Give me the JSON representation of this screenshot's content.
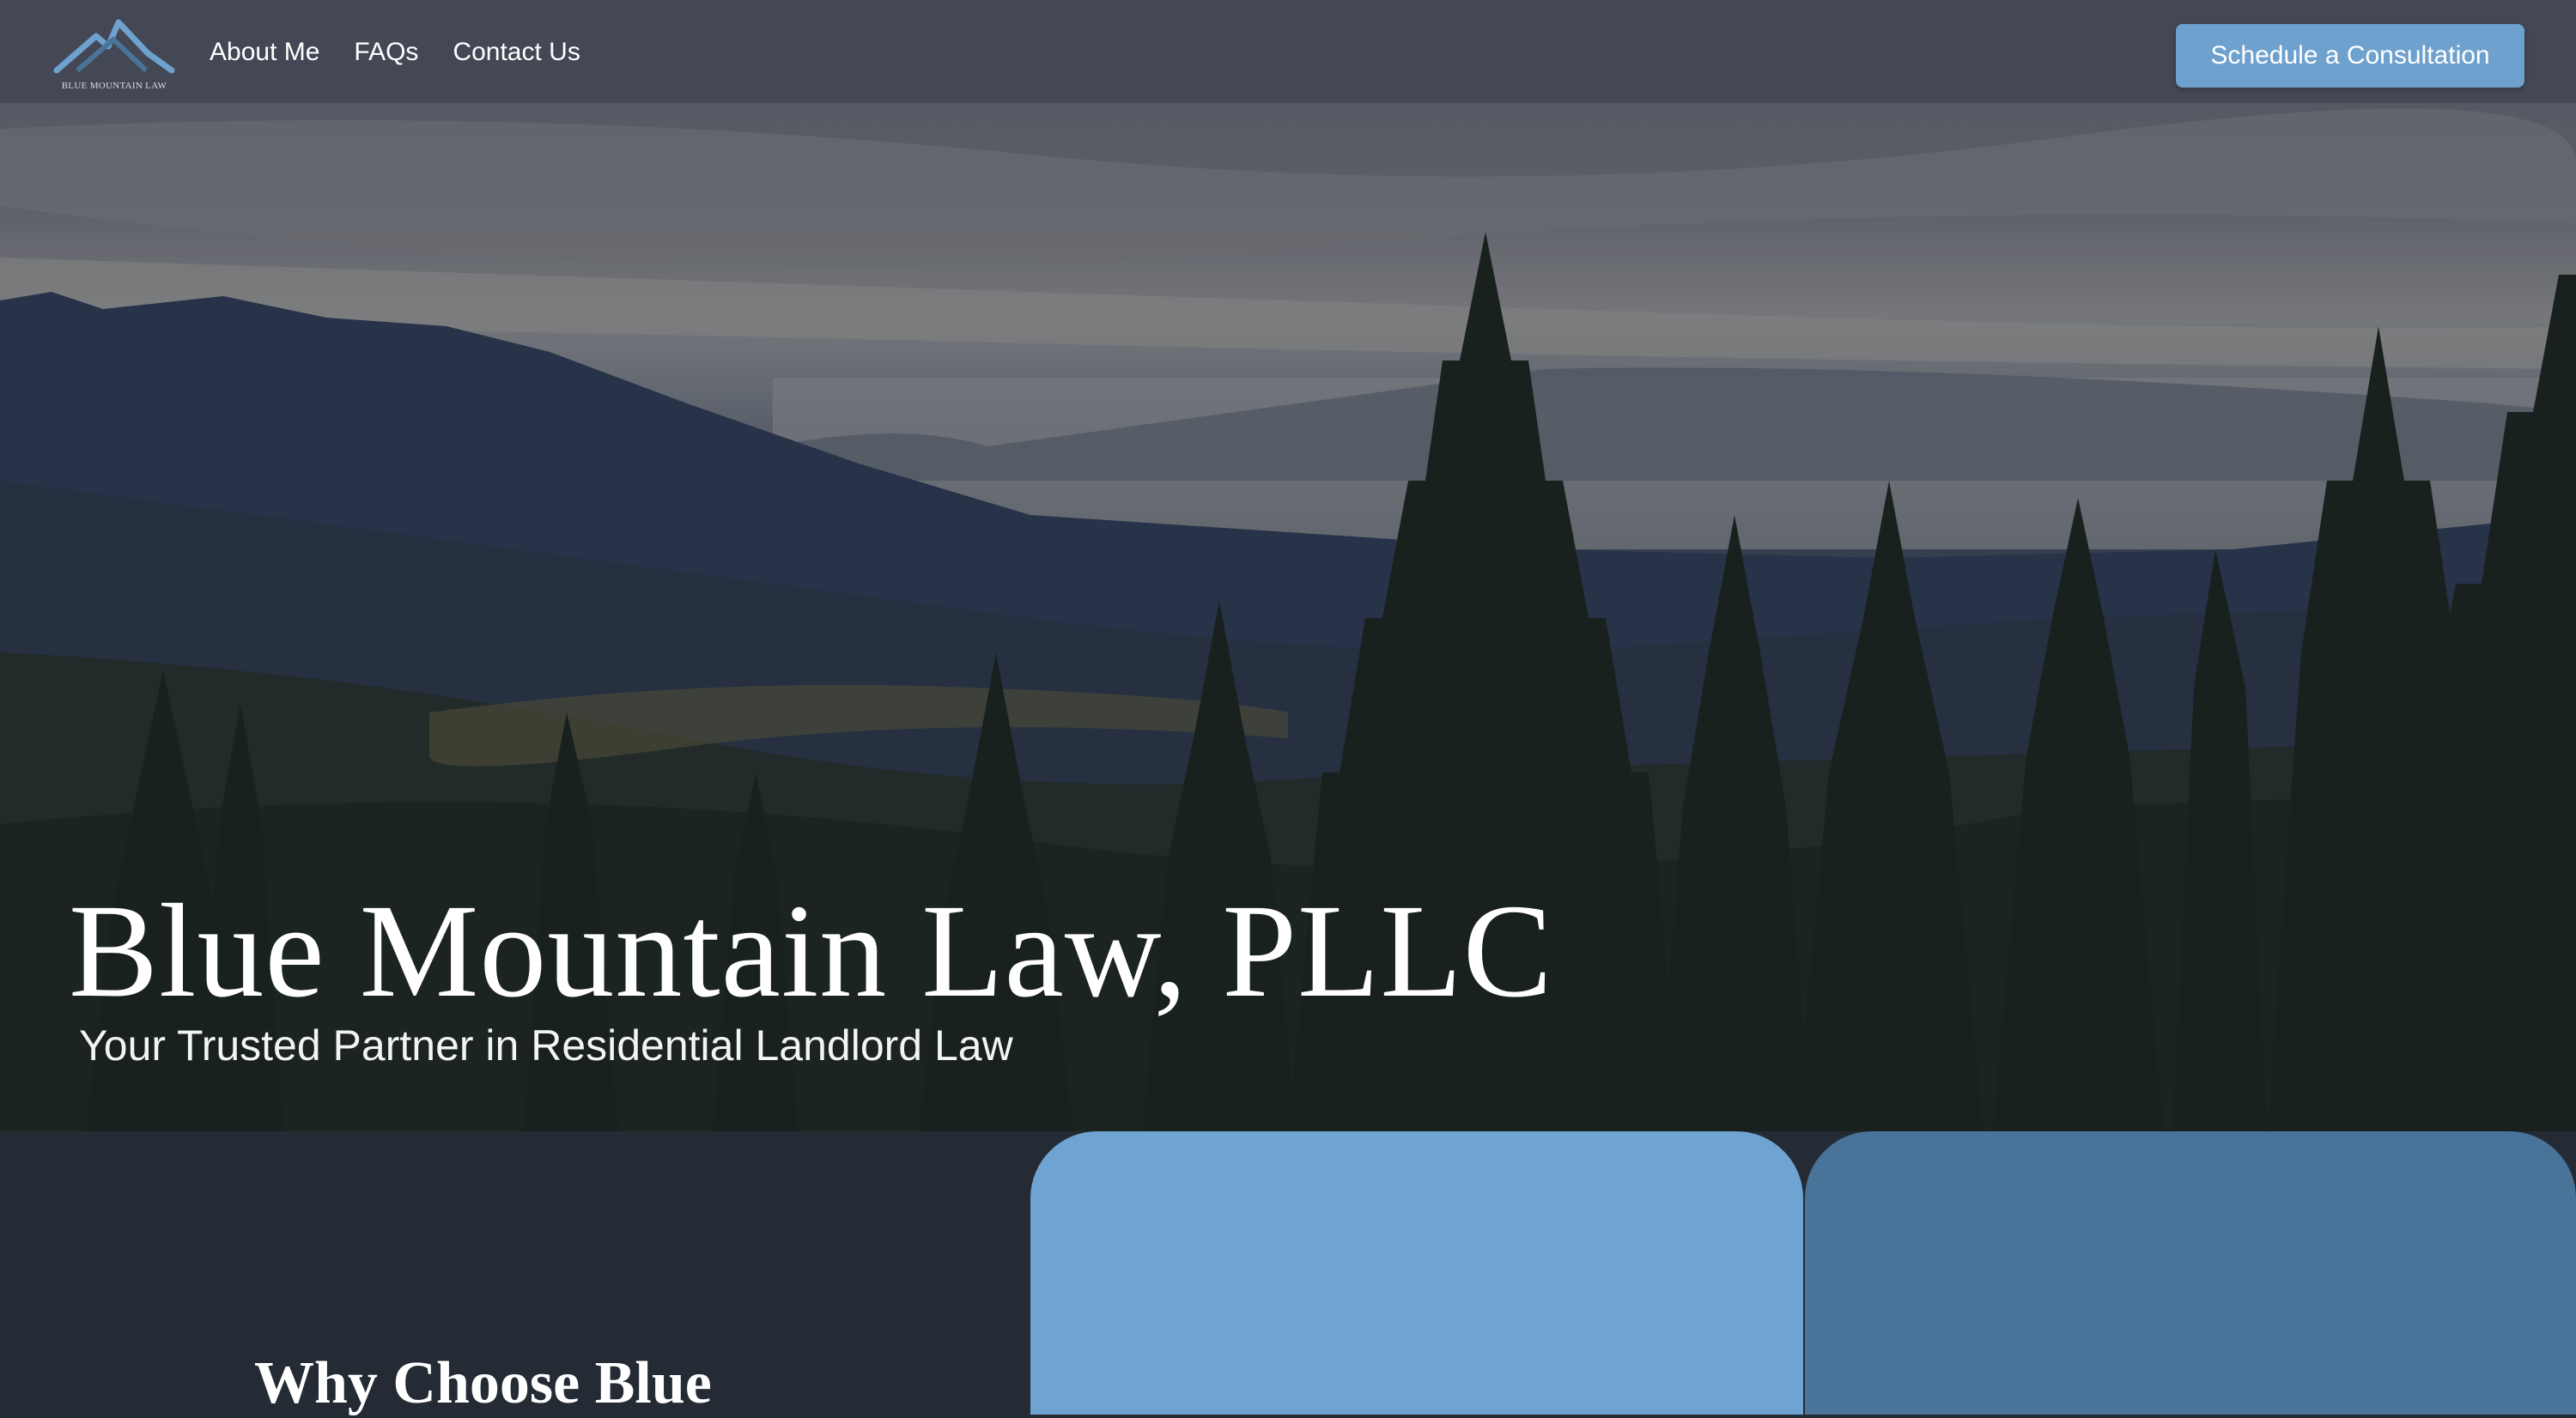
{
  "brand": {
    "logo_text": "BLUE MOUNTAIN LAW",
    "accent": "#6fa1cf",
    "dark_background": "#242b35",
    "card_light": "#6fa3d2",
    "card_dark": "#4a7399"
  },
  "nav": {
    "links": [
      {
        "label": "About Me"
      },
      {
        "label": "FAQs"
      },
      {
        "label": "Contact Us"
      }
    ],
    "cta_label": "Schedule a Consultation"
  },
  "hero": {
    "title": "Blue Mountain Law, PLLC",
    "subtitle": "Your Trusted Partner in Residential Landlord Law",
    "background": "mountain-forest-landscape"
  },
  "section": {
    "heading": "Why Choose Blue"
  }
}
